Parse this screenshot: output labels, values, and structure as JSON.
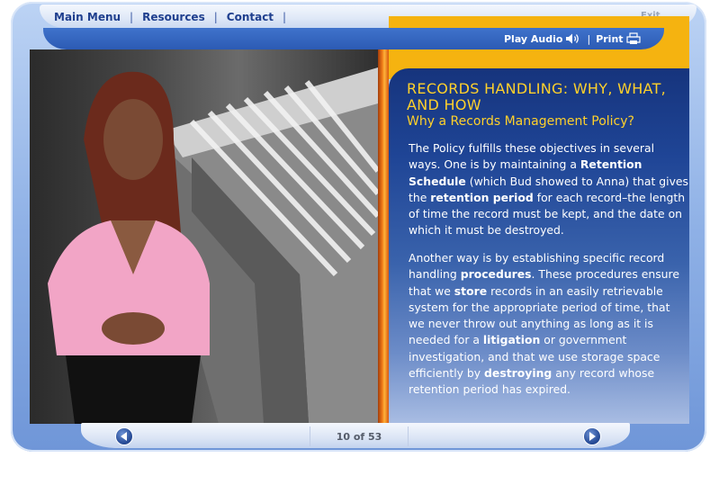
{
  "nav": {
    "items": [
      "Main Menu",
      "Resources",
      "Contact"
    ],
    "exit": "Exit"
  },
  "tools": {
    "play_audio": "Play Audio",
    "print": "Print"
  },
  "content": {
    "title": "RECORDS HANDLING: WHY, WHAT, AND HOW",
    "subtitle": "Why a Records Management Policy?",
    "p1": [
      {
        "t": "The Policy fulfills these objectives in several ways. One is by maintaining a ",
        "b": false
      },
      {
        "t": "Retention Schedule",
        "b": true
      },
      {
        "t": " (which Bud showed to Anna) that gives the ",
        "b": false
      },
      {
        "t": "retention period",
        "b": true
      },
      {
        "t": " for each record–the length of time the record must be kept, and the date on which it must be destroyed.",
        "b": false
      }
    ],
    "p2": [
      {
        "t": "Another way is by establishing specific record handling ",
        "b": false
      },
      {
        "t": "procedures",
        "b": true
      },
      {
        "t": ". These procedures ensure that we ",
        "b": false
      },
      {
        "t": "store",
        "b": true
      },
      {
        "t": " records in an easily retrievable system for the appropriate period of time, that we never throw out anything as long as it is needed for a ",
        "b": false
      },
      {
        "t": "litigation",
        "b": true
      },
      {
        "t": " or government investigation, and that we use storage space efficiently by ",
        "b": false
      },
      {
        "t": "destroying",
        "b": true
      },
      {
        "t": " any record whose retention period has expired.",
        "b": false
      }
    ]
  },
  "pager": {
    "text": "10 of 53"
  },
  "colors": {
    "accent_yellow": "#ffd12b",
    "nav_blue": "#1f3f8e",
    "panel_blue": "#1f4596",
    "divider_orange": "#ef7a17"
  },
  "icons": {
    "audio": "speaker-icon",
    "print": "printer-icon",
    "prev": "arrow-left-icon",
    "next": "arrow-right-icon"
  }
}
